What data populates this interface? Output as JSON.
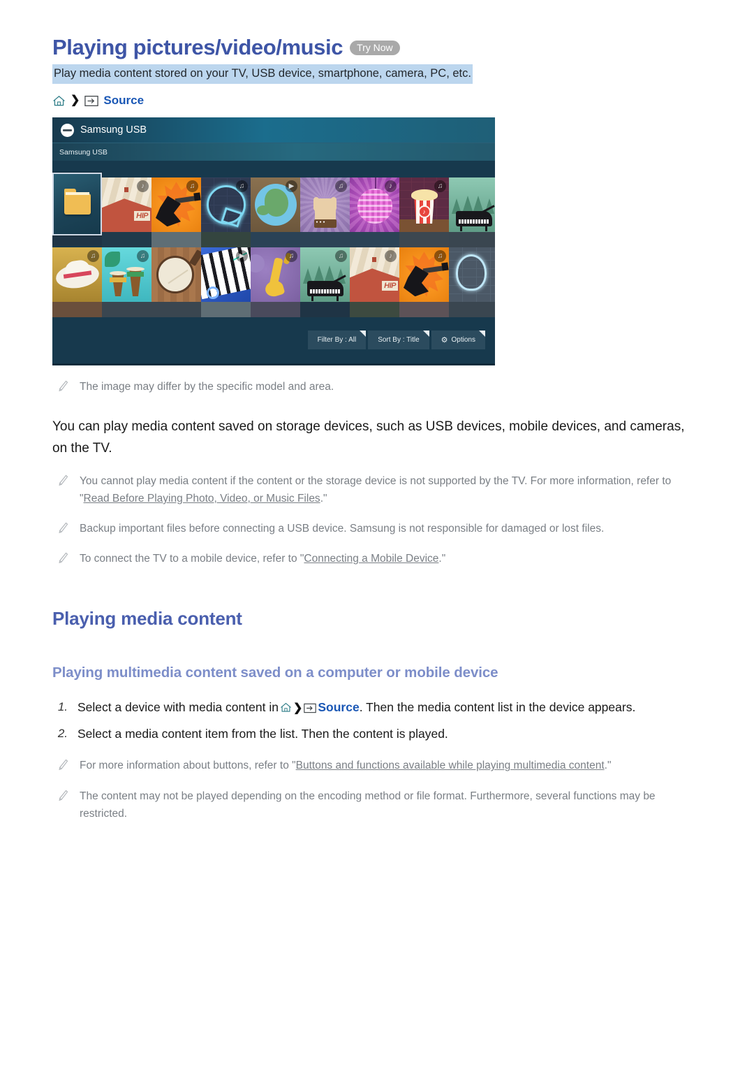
{
  "page": {
    "title": "Playing pictures/video/music",
    "try_now_label": "Try Now",
    "subtitle": "Play media content stored on your TV, USB device, smartphone, camera, PC, etc.",
    "breadcrumb": {
      "home_icon": "home-icon",
      "separator": "❯",
      "source_icon": "source-input-icon",
      "source_label": "Source"
    }
  },
  "tv_screenshot": {
    "header_title": "Samsung USB",
    "header_icon": "usb-device-icon",
    "subbar_label": "Samsung USB",
    "rows": [
      {
        "tiles": [
          {
            "name": "folder",
            "badge": "",
            "selected": true
          },
          {
            "name": "hip-hop-house",
            "badge": "♪"
          },
          {
            "name": "electric-guitar-flames",
            "badge": "♫"
          },
          {
            "name": "neon-music-note",
            "badge": "♫"
          },
          {
            "name": "globe",
            "badge": "▶"
          },
          {
            "name": "rock-hand",
            "badge": "♫"
          },
          {
            "name": "disco-ball",
            "badge": "♪"
          },
          {
            "name": "popcorn",
            "badge": "♫"
          },
          {
            "name": "grand-piano",
            "badge": ""
          }
        ]
      },
      {
        "tiles": [
          {
            "name": "cowboy-hat",
            "badge": "♫"
          },
          {
            "name": "conga-drums",
            "badge": "♫"
          },
          {
            "name": "banjo",
            "badge": ""
          },
          {
            "name": "piano-keys",
            "badge": "▶"
          },
          {
            "name": "saxophone",
            "badge": "♫"
          },
          {
            "name": "grand-piano-2",
            "badge": "♫"
          },
          {
            "name": "hip-hop-house-2",
            "badge": "♪"
          },
          {
            "name": "electric-guitar-flames-2",
            "badge": "♫"
          },
          {
            "name": "neon-guitar-brick",
            "badge": ""
          }
        ]
      }
    ],
    "toolbar": [
      {
        "label": "Filter By : All",
        "icon": ""
      },
      {
        "label": "Sort By : Title",
        "icon": ""
      },
      {
        "label": "Options",
        "icon": "gear-icon"
      }
    ]
  },
  "notes": {
    "image_differ": "The image may differ by the specific model and area.",
    "body_paragraph": "You can play media content saved on storage devices, such as USB devices, mobile devices, and cameras, on the TV.",
    "cannot_play_a": "You cannot play media content if the content or the storage device is not supported by the TV. For more information, refer to \"",
    "cannot_play_link": "Read Before Playing Photo, Video, or Music Files",
    "cannot_play_b": ".\"",
    "backup": "Backup important files before connecting a USB device. Samsung is not responsible for damaged or lost files.",
    "connect_a": "To connect the TV to a mobile device, refer to \"",
    "connect_link": "Connecting a Mobile Device",
    "connect_b": ".\""
  },
  "section": {
    "heading": "Playing media content",
    "subheading": "Playing multimedia content saved on a computer or mobile device",
    "steps": [
      {
        "num": "1.",
        "before": "Select a device with media content in",
        "source_label": "Source",
        "after": ". Then the media content list in the device appears."
      },
      {
        "num": "2.",
        "before": "Select a media content item from the list. Then the content is played.",
        "source_label": "",
        "after": ""
      }
    ],
    "footnotes": {
      "buttons_a": "For more information about buttons, refer to \"",
      "buttons_link": "Buttons and functions available while playing multimedia content",
      "buttons_b": ".\"",
      "encoding": "The content may not be played depending on the encoding method or file format. Furthermore, several functions may be restricted."
    }
  },
  "colors": {
    "title_blue": "#3e55a6",
    "link_blue": "#1a57b5",
    "subtitle_highlight": "#bcd6ee",
    "note_gray": "#7a7f85",
    "h3_blue": "#7d8ec9",
    "tv_bg": "#17394d"
  }
}
